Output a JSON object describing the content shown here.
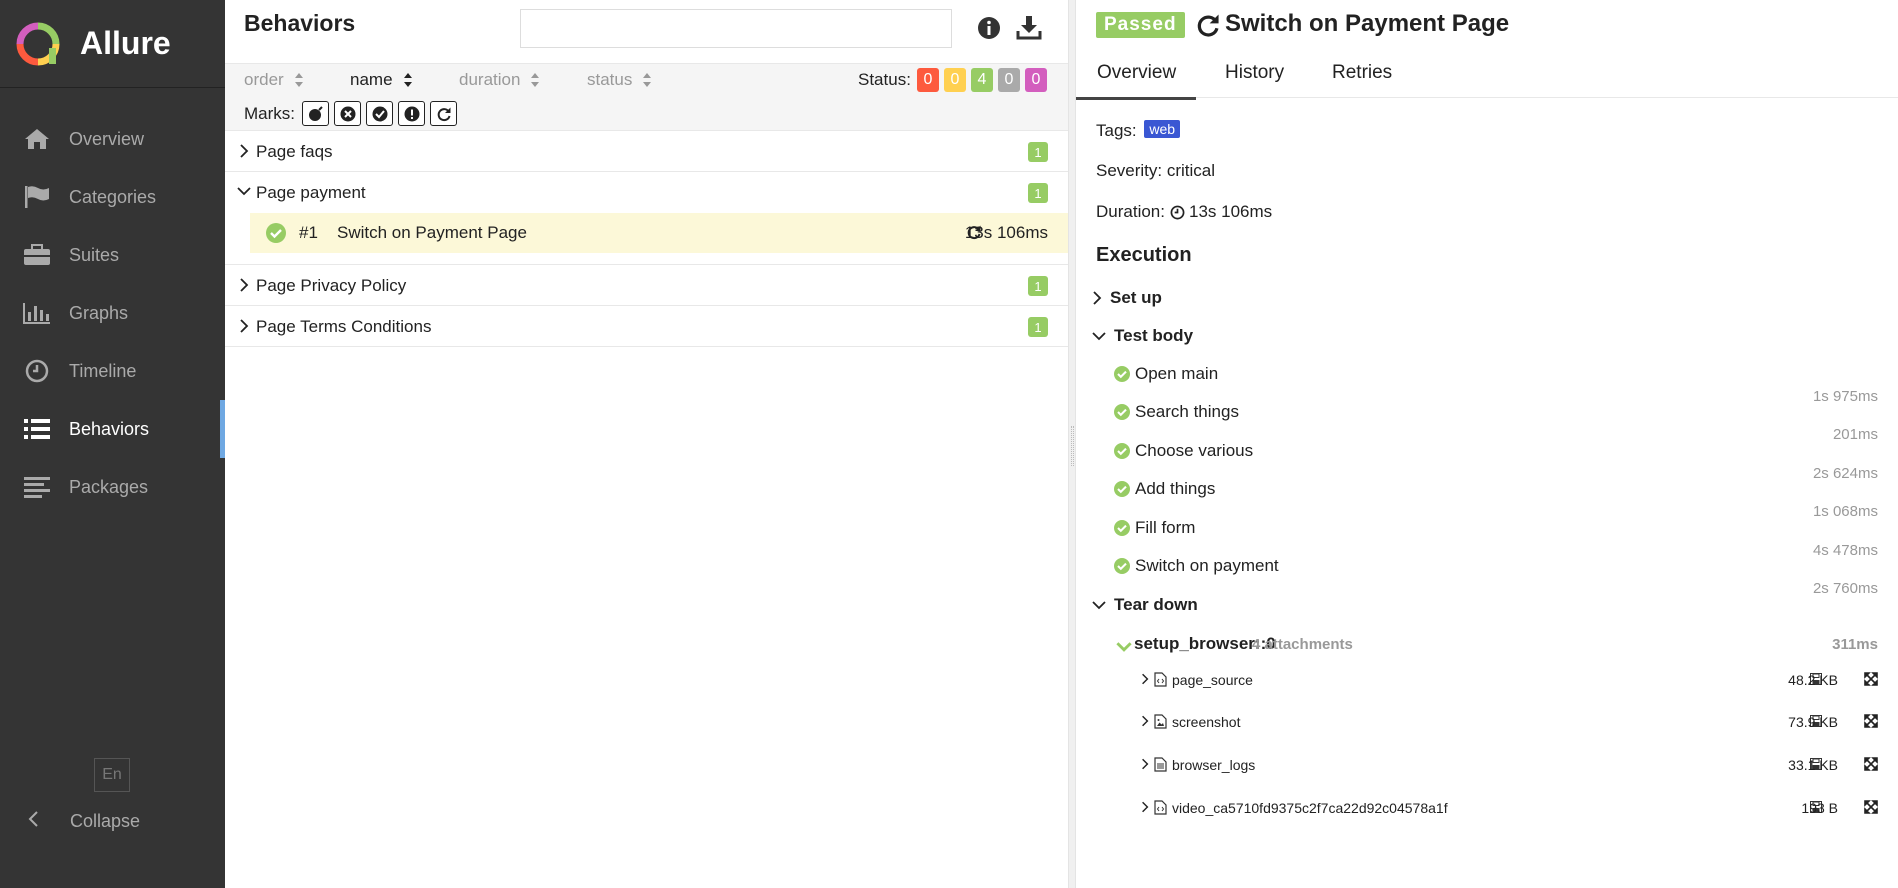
{
  "app": {
    "name": "Allure"
  },
  "sidebar": {
    "items": [
      {
        "label": "Overview",
        "icon": "home-icon"
      },
      {
        "label": "Categories",
        "icon": "flag-icon"
      },
      {
        "label": "Suites",
        "icon": "briefcase-icon"
      },
      {
        "label": "Graphs",
        "icon": "bar-chart-icon"
      },
      {
        "label": "Timeline",
        "icon": "clock-icon"
      },
      {
        "label": "Behaviors",
        "icon": "list-icon",
        "active": true
      },
      {
        "label": "Packages",
        "icon": "align-left-icon"
      }
    ],
    "language": "En",
    "collapse_label": "Collapse"
  },
  "behaviors": {
    "title": "Behaviors",
    "search_value": "",
    "sort": {
      "order": "order",
      "name": "name",
      "duration": "duration",
      "status": "status"
    },
    "status_label": "Status:",
    "status_counts": [
      {
        "value": "0",
        "color": "#fd5a3e"
      },
      {
        "value": "0",
        "color": "#ffd050"
      },
      {
        "value": "4",
        "color": "#97cc64"
      },
      {
        "value": "0",
        "color": "#aaaaaa"
      },
      {
        "value": "0",
        "color": "#d35ebe"
      }
    ],
    "marks_label": "Marks:",
    "groups": [
      {
        "name": "Page faqs",
        "count": "1",
        "expanded": false
      },
      {
        "name": "Page payment",
        "count": "1",
        "expanded": true
      },
      {
        "name": "Page Privacy Policy",
        "count": "1",
        "expanded": false
      },
      {
        "name": "Page Terms Conditions",
        "count": "1",
        "expanded": false
      }
    ],
    "selected_test": {
      "number": "#1",
      "name": "Switch on Payment Page",
      "duration": "13s 106ms"
    }
  },
  "detail": {
    "status": "Passed",
    "title": "Switch on Payment Page",
    "tabs": [
      "Overview",
      "History",
      "Retries"
    ],
    "tags_label": "Tags:",
    "tag": "web",
    "severity": "Severity: critical",
    "duration_label": "Duration:",
    "duration": "13s 106ms",
    "execution_title": "Execution",
    "set_up": "Set up",
    "test_body": "Test body",
    "steps": [
      {
        "name": "Open main",
        "duration": "1s 975ms"
      },
      {
        "name": "Search things",
        "duration": "201ms"
      },
      {
        "name": "Choose various",
        "duration": "2s 624ms"
      },
      {
        "name": "Add things",
        "duration": "1s 068ms"
      },
      {
        "name": "Fill form",
        "duration": "4s 478ms"
      },
      {
        "name": "Switch on payment",
        "duration": "2s 760ms"
      }
    ],
    "tear_down": "Tear down",
    "teardown_fixture": {
      "name": "setup_browser::0",
      "attachments_label": "4 attachments",
      "duration": "311ms"
    },
    "attachments": [
      {
        "name": "page_source",
        "size": "48.2 KB",
        "icon": "code-file-icon"
      },
      {
        "name": "screenshot",
        "size": "73.9 KB",
        "icon": "image-file-icon"
      },
      {
        "name": "browser_logs",
        "size": "33.1 KB",
        "icon": "text-file-icon"
      },
      {
        "name": "video_ca5710fd9375c2f7ca22d92c04578a1f",
        "size": "193 B",
        "icon": "code-file-icon"
      }
    ]
  }
}
